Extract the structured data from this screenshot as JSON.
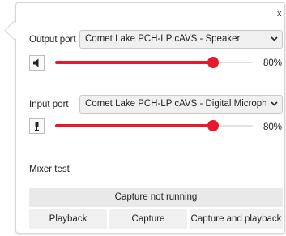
{
  "close_label": "x",
  "output": {
    "label": "Output port",
    "selected": "Comet Lake PCH-LP cAVS - Speaker",
    "icon": "speaker-icon",
    "volume": 0.8,
    "volume_label": "80%"
  },
  "input": {
    "label": "Input port",
    "selected": "Comet Lake PCH-LP cAVS - Digital Microphone",
    "icon": "microphone-icon",
    "volume": 0.8,
    "volume_label": "80%"
  },
  "mixer": {
    "label": "Mixer test",
    "status": "Capture not running",
    "buttons": {
      "playback": "Playback",
      "capture": "Capture",
      "capture_and_playback": "Capture and playback"
    }
  },
  "colors": {
    "accent": "#e8192c"
  }
}
